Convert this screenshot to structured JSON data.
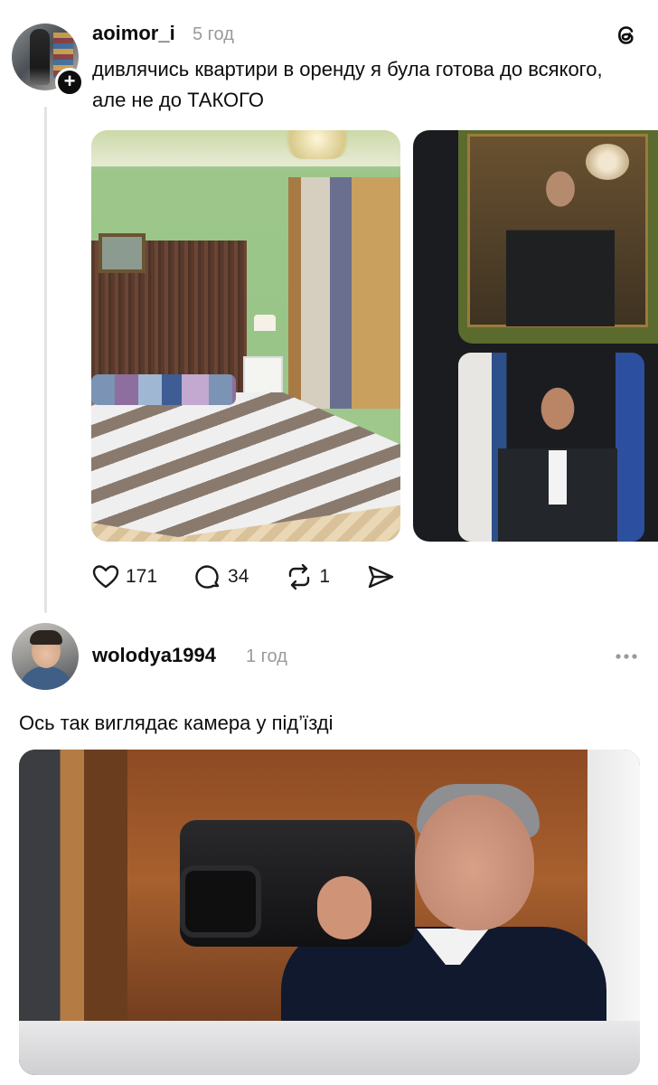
{
  "post1": {
    "username": "aoimor_i",
    "time": "5 год",
    "follow_symbol": "+",
    "text": "дивлячись квартири в оренду я була готова до всякого, але не до ТАКОГО",
    "actions": {
      "likes": "171",
      "comments": "34",
      "reposts": "1"
    },
    "icons": [
      "heart-icon",
      "comment-icon",
      "repost-icon",
      "share-icon",
      "threads-logo-icon"
    ]
  },
  "post2": {
    "username": "wolodya1994",
    "time": "1 год",
    "text": "Ось так виглядає камера у під’їзді",
    "icons": [
      "more-icon"
    ]
  },
  "colors": {
    "text": "#0d0d0d",
    "secondary": "#9a9a9a",
    "thread_line": "#e3e3e3"
  }
}
